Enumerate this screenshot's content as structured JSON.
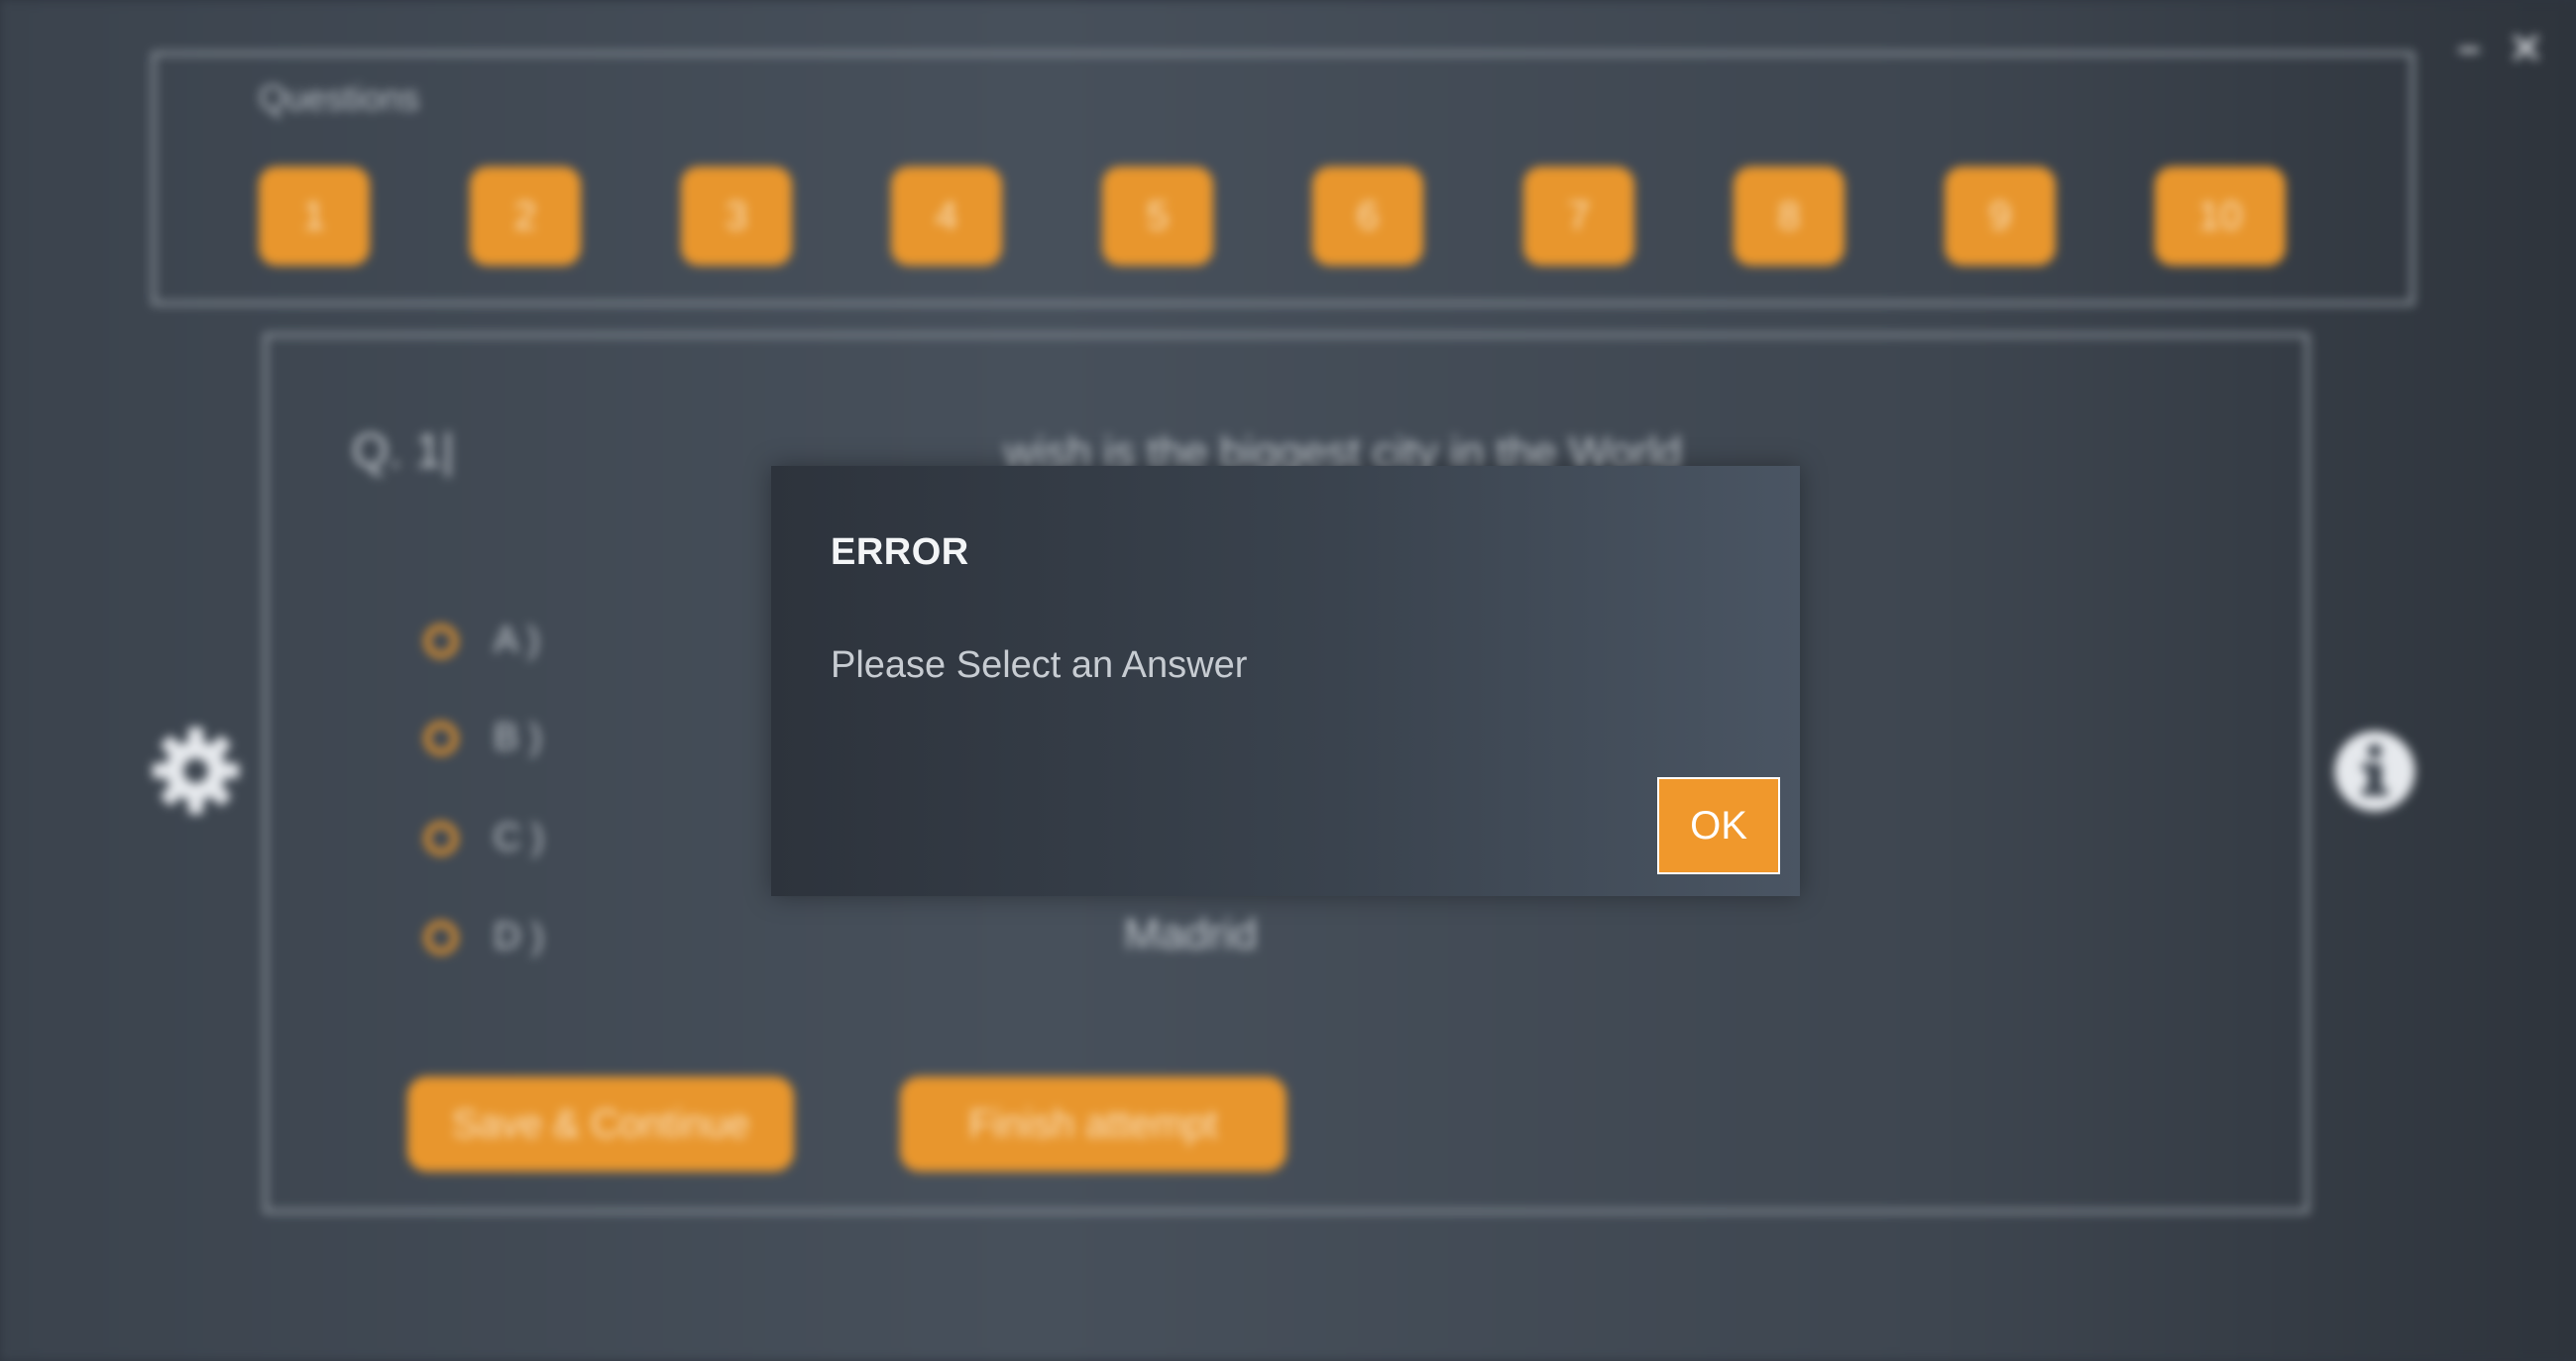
{
  "window": {
    "minimize_icon": "minimize-icon",
    "close_icon": "close-icon"
  },
  "questions": {
    "title": "Questions",
    "numbers": [
      "1",
      "2",
      "3",
      "4",
      "5",
      "6",
      "7",
      "8",
      "9",
      "10"
    ]
  },
  "question": {
    "label": "Q. 1|",
    "text": "wish is the biggest city in the World",
    "options": [
      {
        "label": "A )",
        "answer": ""
      },
      {
        "label": "B )",
        "answer": ""
      },
      {
        "label": "C )",
        "answer": ""
      },
      {
        "label": "D )",
        "answer": "Madrid"
      }
    ]
  },
  "actions": {
    "save": "Save & Continue",
    "finish": "Finish attempt"
  },
  "icons": {
    "settings": "gear-icon",
    "info": "info-icon"
  },
  "dialog": {
    "title": "ERROR",
    "message": "Please Select an Answer",
    "ok": "OK"
  },
  "colors": {
    "accent": "#e8962d",
    "background": "#3b434d"
  }
}
